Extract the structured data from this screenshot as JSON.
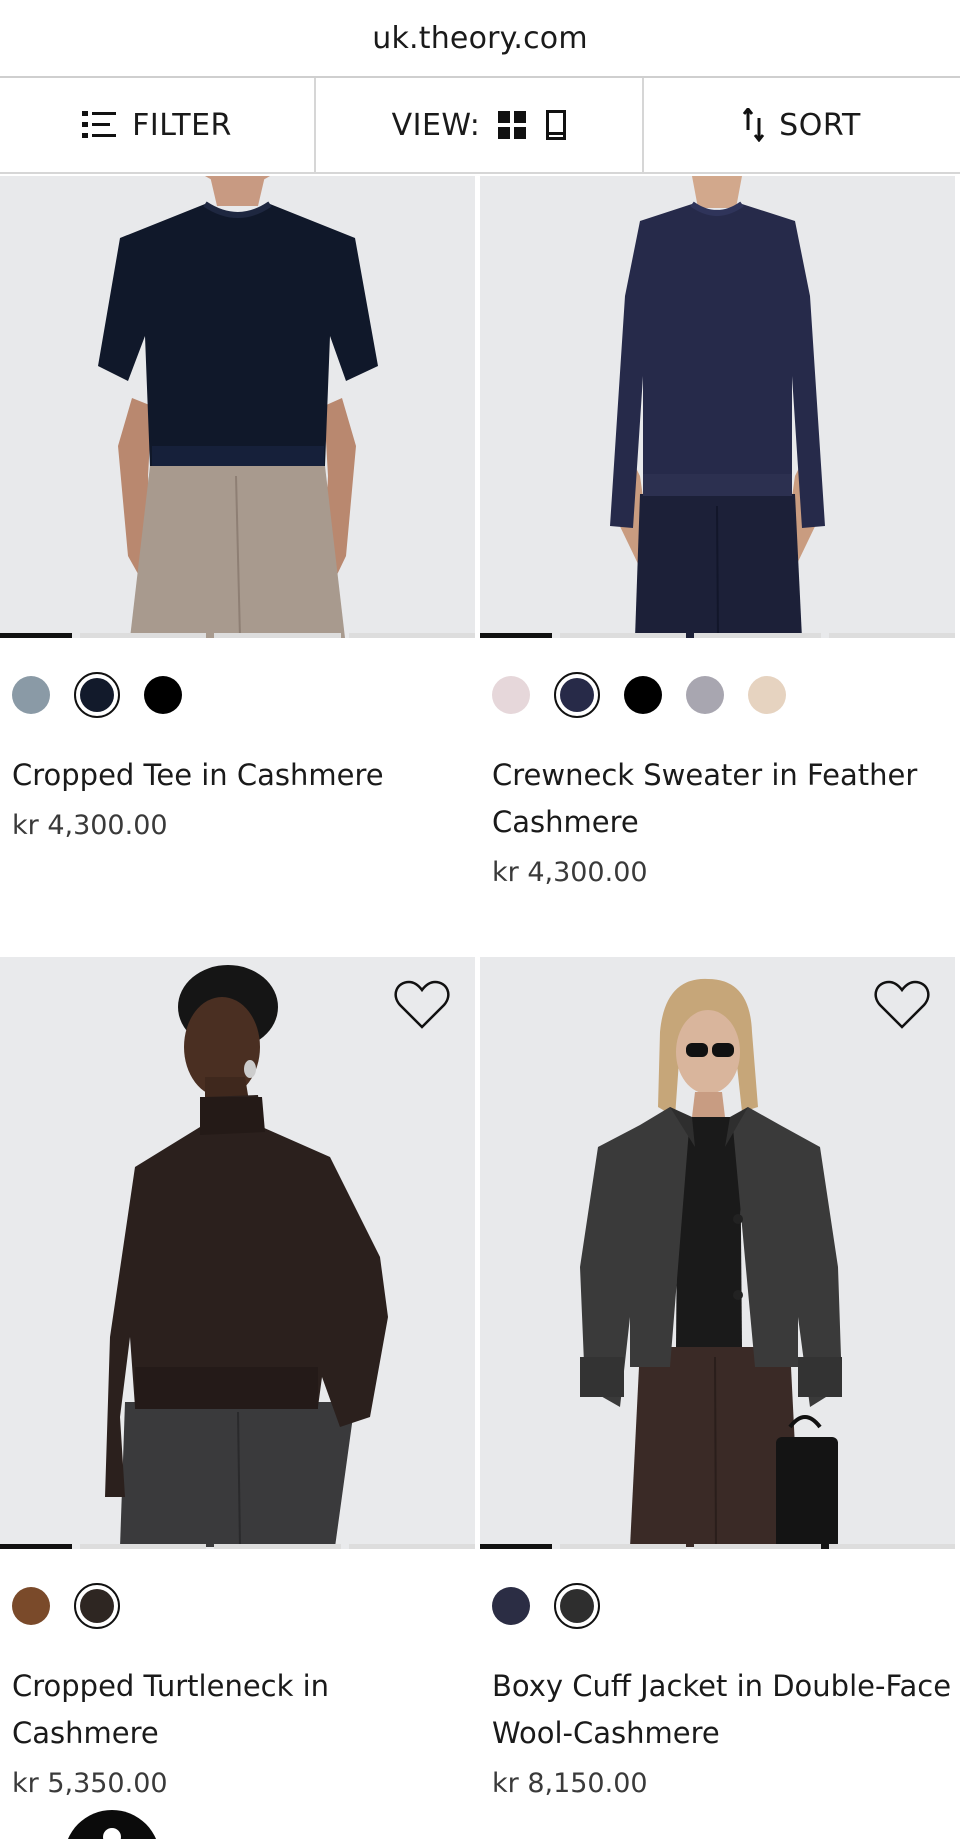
{
  "browser": {
    "url": "uk.theory.com"
  },
  "toolbar": {
    "filter_label": "FILTER",
    "view_label": "VIEW:",
    "sort_label": "SORT",
    "icons": [
      "filter-list-icon",
      "grid-view-icon",
      "single-view-icon",
      "sort-arrows-icon"
    ]
  },
  "products": [
    {
      "name": "Cropped Tee in Cashmere",
      "price": "kr 4,300.00",
      "swatches": [
        "#8a9aa6",
        "#121a2b",
        "#000000"
      ],
      "selected_swatch": 1,
      "image_page": "1",
      "has_wishlist_icon": false
    },
    {
      "name": "Crewneck Sweater in Feather Cashmere",
      "price": "kr 4,300.00",
      "swatches": [
        "#e6d7da",
        "#272a48",
        "#000000",
        "#a8a6b0",
        "#e6d3c0"
      ],
      "selected_swatch": 1,
      "image_page": "1",
      "has_wishlist_icon": false
    },
    {
      "name": "Cropped Turtleneck in Cashmere",
      "price": "kr 5,350.00",
      "swatches": [
        "#7a4a2a",
        "#2e2622"
      ],
      "selected_swatch": 1,
      "image_page": "1",
      "has_wishlist_icon": true
    },
    {
      "name": "Boxy Cuff Jacket in Double-Face Wool-Cashmere",
      "price": "kr 8,150.00",
      "swatches": [
        "#2b2d44",
        "#2e2e2e"
      ],
      "selected_swatch": 1,
      "image_page": "1",
      "has_wishlist_icon": true
    }
  ],
  "colors": {
    "photo_background": "#e8e9eb",
    "progress_active": "#111111",
    "progress_inactive": "#dddddd",
    "divider": "#d6d6d6"
  }
}
